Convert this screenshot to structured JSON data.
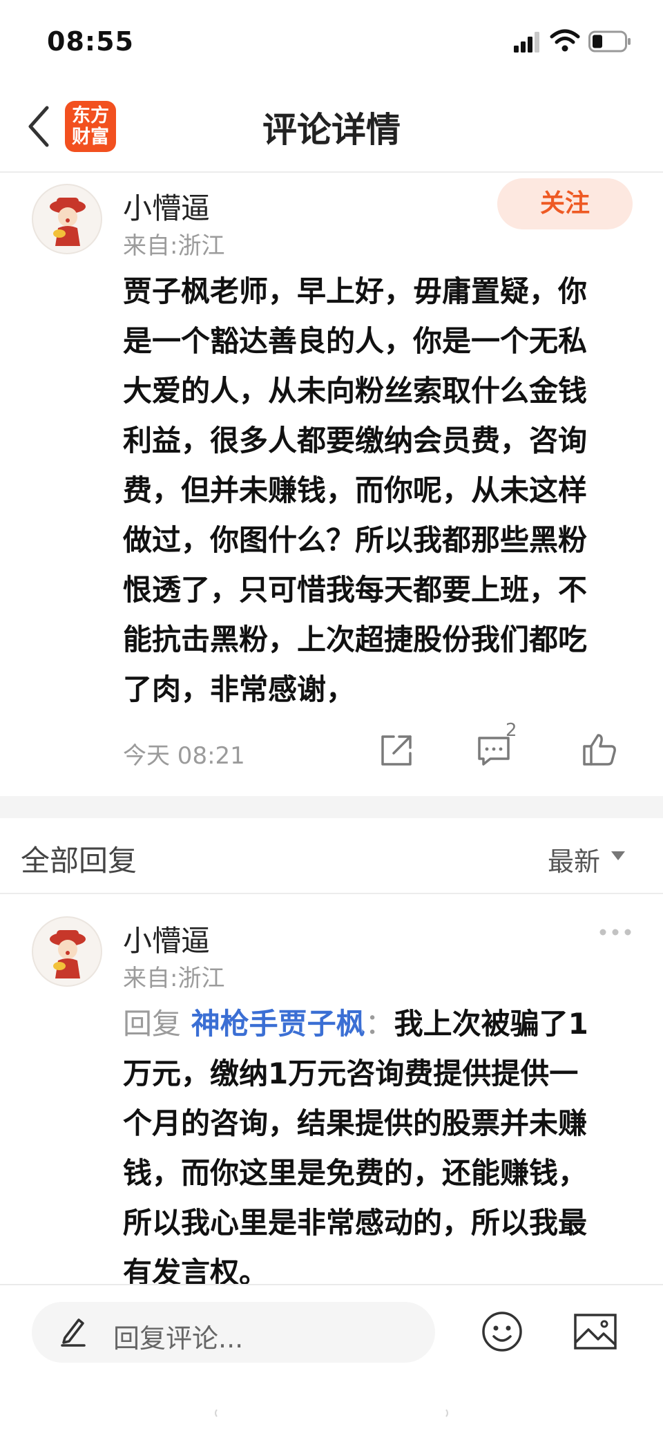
{
  "status_bar": {
    "time": "08:55"
  },
  "header": {
    "title": "评论详情",
    "logo_line1": "东方",
    "logo_line2": "财富"
  },
  "post": {
    "username": "小懵逼",
    "location": "来自:浙江",
    "follow_label": "关注",
    "lines": [
      "贾子枫老师，早上好，毋庸置疑，你",
      "是一个豁达善良的人，你是一个无私",
      "大爱的人，从未向粉丝索取什么金钱",
      "利益，很多人都要缴纳会员费，咨询",
      "费，但并未赚钱，而你呢，从未这样",
      "做过，你图什么？所以我都那些黑粉",
      "恨透了，只可惜我每天都要上班，不",
      "能抗击黑粉，上次超捷股份我们都吃",
      "了肉，非常感谢，"
    ],
    "time": "今天 08:21",
    "comment_count": "2"
  },
  "replies_header": {
    "title": "全部回复",
    "sort_label": "最新"
  },
  "reply": {
    "username": "小懵逼",
    "location": "来自:浙江",
    "prefix": "回复",
    "mention": "神枪手贾子枫",
    "colon": "：",
    "first_line": "我上次被骗了1",
    "lines": [
      "万元，缴纳1万元咨询费提供提供一",
      "个月的咨询，结果提供的股票并未赚",
      "钱，而你这里是免费的，还能赚钱，",
      "所以我心里是非常感动的，所以我最",
      "有发言权。"
    ]
  },
  "bottom_bar": {
    "placeholder": "回复评论..."
  },
  "colors": {
    "accent": "#ee5a24",
    "logo": "#f2501f",
    "mention": "#3b6fd4"
  },
  "icons": [
    "back-chevron-icon",
    "signal-icon",
    "wifi-icon",
    "battery-icon",
    "share-icon",
    "comment-icon",
    "like-icon",
    "more-dots-icon",
    "pencil-icon",
    "emoji-icon",
    "image-icon"
  ]
}
